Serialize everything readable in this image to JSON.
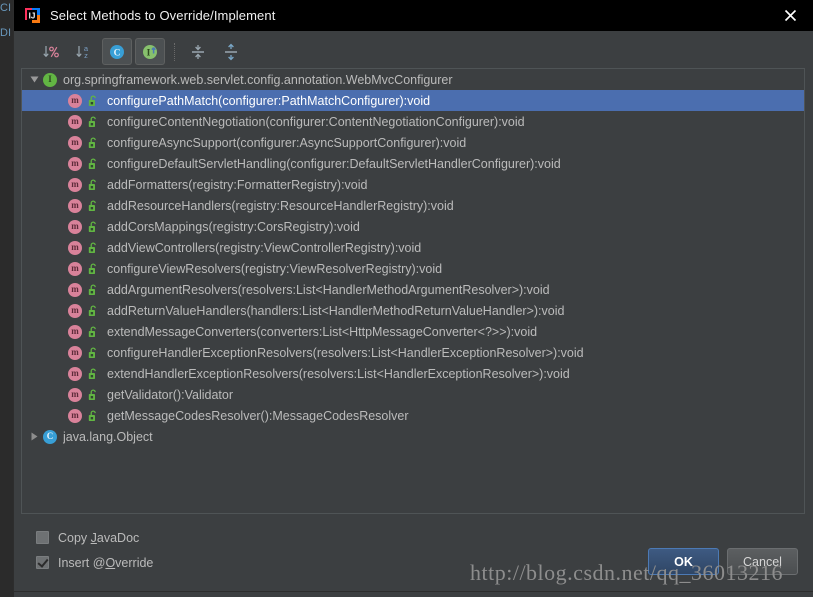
{
  "window": {
    "title": "Select Methods to Override/Implement",
    "app_icon": "intellij-idea-icon",
    "close_icon": "close-icon"
  },
  "ide_background": {
    "ghost_lines": [
      "CI",
      "DI"
    ]
  },
  "toolbar": {
    "buttons": [
      {
        "name": "sort-by-visibility-button",
        "icon": "sort-percent-icon",
        "label": "Sort by visibility",
        "toggled": false
      },
      {
        "name": "sort-alphabetically-button",
        "icon": "sort-alphabetical-icon",
        "label": "Sort alphabetically",
        "toggled": false
      },
      {
        "name": "show-classes-button",
        "icon": "class-C-icon",
        "label": "C",
        "toggled": true
      },
      {
        "name": "show-interfaces-button",
        "icon": "interface-I-icon",
        "label": "I",
        "toggled": true
      },
      {
        "name": "expand-all-button",
        "icon": "expand-all-icon",
        "label": "Expand All",
        "toggled": false
      },
      {
        "name": "collapse-all-button",
        "icon": "collapse-all-icon",
        "label": "Collapse All",
        "toggled": false
      }
    ]
  },
  "tree": {
    "nodes": [
      {
        "kind": "root",
        "expanded": true,
        "icon": "interface-icon",
        "icon_letter": "I",
        "icon_color": "#62b543",
        "label": "org.springframework.web.servlet.config.annotation.WebMvcConfigurer",
        "selected": false
      },
      {
        "kind": "method",
        "icon": "method-icon",
        "icon_letter": "m",
        "visibility_icon": "public-lock-icon",
        "label": "configurePathMatch(configurer:PathMatchConfigurer):void",
        "selected": true
      },
      {
        "kind": "method",
        "icon": "method-icon",
        "icon_letter": "m",
        "visibility_icon": "public-lock-icon",
        "label": "configureContentNegotiation(configurer:ContentNegotiationConfigurer):void",
        "selected": false
      },
      {
        "kind": "method",
        "icon": "method-icon",
        "icon_letter": "m",
        "visibility_icon": "public-lock-icon",
        "label": "configureAsyncSupport(configurer:AsyncSupportConfigurer):void",
        "selected": false
      },
      {
        "kind": "method",
        "icon": "method-icon",
        "icon_letter": "m",
        "visibility_icon": "public-lock-icon",
        "label": "configureDefaultServletHandling(configurer:DefaultServletHandlerConfigurer):void",
        "selected": false
      },
      {
        "kind": "method",
        "icon": "method-icon",
        "icon_letter": "m",
        "visibility_icon": "public-lock-icon",
        "label": "addFormatters(registry:FormatterRegistry):void",
        "selected": false
      },
      {
        "kind": "method",
        "icon": "method-icon",
        "icon_letter": "m",
        "visibility_icon": "public-lock-icon",
        "label": "addResourceHandlers(registry:ResourceHandlerRegistry):void",
        "selected": false
      },
      {
        "kind": "method",
        "icon": "method-icon",
        "icon_letter": "m",
        "visibility_icon": "public-lock-icon",
        "label": "addCorsMappings(registry:CorsRegistry):void",
        "selected": false
      },
      {
        "kind": "method",
        "icon": "method-icon",
        "icon_letter": "m",
        "visibility_icon": "public-lock-icon",
        "label": "addViewControllers(registry:ViewControllerRegistry):void",
        "selected": false
      },
      {
        "kind": "method",
        "icon": "method-icon",
        "icon_letter": "m",
        "visibility_icon": "public-lock-icon",
        "label": "configureViewResolvers(registry:ViewResolverRegistry):void",
        "selected": false
      },
      {
        "kind": "method",
        "icon": "method-icon",
        "icon_letter": "m",
        "visibility_icon": "public-lock-icon",
        "label": "addArgumentResolvers(resolvers:List<HandlerMethodArgumentResolver>):void",
        "selected": false
      },
      {
        "kind": "method",
        "icon": "method-icon",
        "icon_letter": "m",
        "visibility_icon": "public-lock-icon",
        "label": "addReturnValueHandlers(handlers:List<HandlerMethodReturnValueHandler>):void",
        "selected": false
      },
      {
        "kind": "method",
        "icon": "method-icon",
        "icon_letter": "m",
        "visibility_icon": "public-lock-icon",
        "label": "extendMessageConverters(converters:List<HttpMessageConverter<?>>):void",
        "selected": false
      },
      {
        "kind": "method",
        "icon": "method-icon",
        "icon_letter": "m",
        "visibility_icon": "public-lock-icon",
        "label": "configureHandlerExceptionResolvers(resolvers:List<HandlerExceptionResolver>):void",
        "selected": false
      },
      {
        "kind": "method",
        "icon": "method-icon",
        "icon_letter": "m",
        "visibility_icon": "public-lock-icon",
        "label": "extendHandlerExceptionResolvers(resolvers:List<HandlerExceptionResolver>):void",
        "selected": false
      },
      {
        "kind": "method",
        "icon": "method-icon",
        "icon_letter": "m",
        "visibility_icon": "public-lock-icon",
        "label": "getValidator():Validator",
        "selected": false
      },
      {
        "kind": "method",
        "icon": "method-icon",
        "icon_letter": "m",
        "visibility_icon": "public-lock-icon",
        "label": "getMessageCodesResolver():MessageCodesResolver",
        "selected": false
      },
      {
        "kind": "root",
        "expanded": false,
        "icon": "class-icon",
        "icon_letter": "C",
        "icon_color": "#389fd6",
        "label": "java.lang.Object",
        "selected": false
      }
    ]
  },
  "options": {
    "copy_javadoc": {
      "label_before": "Copy ",
      "mnemonic": "J",
      "label_after": "avaDoc",
      "checked": false
    },
    "insert_override": {
      "label_before": "Insert @",
      "mnemonic": "O",
      "label_after": "verride",
      "checked": true
    }
  },
  "buttons": {
    "ok": "OK",
    "cancel": "Cancel"
  },
  "watermark": {
    "text": "http://blog.csdn.net/qq_36013216"
  },
  "colors": {
    "dialog_bg": "#3c3f41",
    "titlebar_bg": "#000000",
    "selection_blue": "#4b6eaf",
    "text": "#bbbbbb",
    "method_icon": "#d9829a",
    "lock_green": "#62b543",
    "interface_green": "#62b543",
    "class_blue": "#389fd6",
    "primary_button": "#3e5a82"
  }
}
